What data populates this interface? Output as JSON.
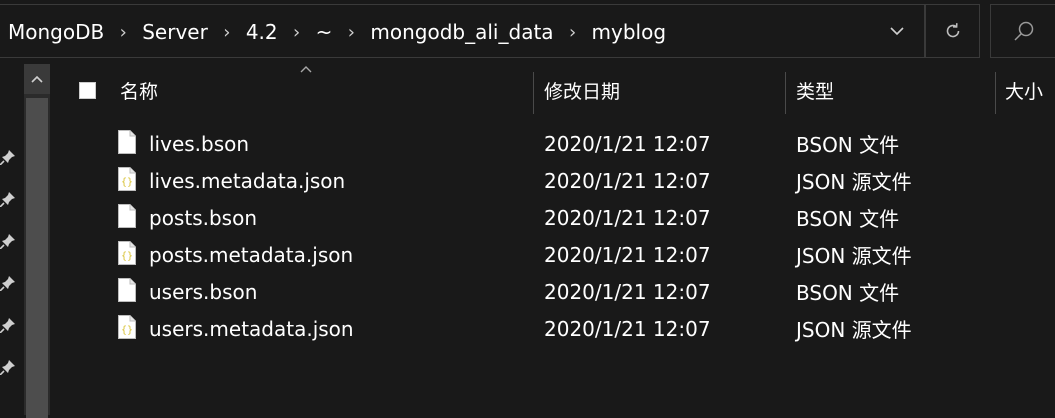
{
  "address_bar": {
    "crumbs": [
      "MongoDB",
      "Server",
      "4.2",
      "~",
      "mongodb_ali_data",
      "myblog"
    ],
    "separator": "›"
  },
  "columns": {
    "name": "名称",
    "date_modified": "修改日期",
    "type": "类型",
    "size": "大小"
  },
  "files": [
    {
      "name": "lives.bson",
      "date": "2020/1/21 12:07",
      "type": "BSON 文件",
      "icon": "blank-file-icon"
    },
    {
      "name": "lives.metadata.json",
      "date": "2020/1/21 12:07",
      "type": "JSON 源文件",
      "icon": "json-file-icon"
    },
    {
      "name": "posts.bson",
      "date": "2020/1/21 12:07",
      "type": "BSON 文件",
      "icon": "blank-file-icon"
    },
    {
      "name": "posts.metadata.json",
      "date": "2020/1/21 12:07",
      "type": "JSON 源文件",
      "icon": "json-file-icon"
    },
    {
      "name": "users.bson",
      "date": "2020/1/21 12:07",
      "type": "BSON 文件",
      "icon": "blank-file-icon"
    },
    {
      "name": "users.metadata.json",
      "date": "2020/1/21 12:07",
      "type": "JSON 源文件",
      "icon": "json-file-icon"
    }
  ],
  "colors": {
    "background": "#191919",
    "text": "#ffffff",
    "border": "#3a3a3a",
    "json_icon_accent": "#d8c234"
  }
}
